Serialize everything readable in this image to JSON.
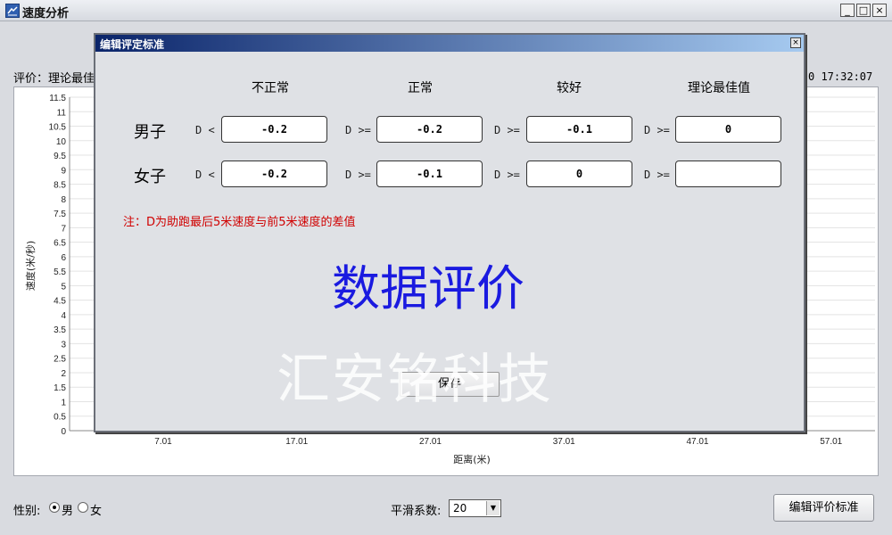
{
  "window": {
    "title": "速度分析",
    "min": "_",
    "max": "□",
    "close": "×"
  },
  "status": {
    "evaluation": "评价：理论最佳",
    "datetime": "0 17:32:07"
  },
  "chart_data": {
    "type": "line",
    "xlabel": "距离(米)",
    "ylabel": "速度(米/秒)",
    "xticks": [
      "7.01",
      "17.01",
      "27.01",
      "37.01",
      "47.01",
      "57.01"
    ],
    "yticks": [
      "0",
      "0.5",
      "1",
      "1.5",
      "2",
      "2.5",
      "3",
      "3.5",
      "4",
      "4.5",
      "5",
      "5.5",
      "6",
      "6.5",
      "7",
      "7.5",
      "8",
      "8.5",
      "9",
      "9.5",
      "10",
      "10.5",
      "11",
      "11.5"
    ],
    "ylim": [
      0,
      11.5
    ],
    "xlim": [
      0,
      57.01
    ],
    "series": [],
    "grid": true
  },
  "controls": {
    "gender_label": "性别:",
    "male": "男",
    "female": "女",
    "selected_gender": "男",
    "smooth_label": "平滑系数:",
    "smooth_value": "20",
    "edit_button": "编辑评价标准"
  },
  "dialog": {
    "title": "编辑评定标准",
    "close": "×",
    "columns": [
      "不正常",
      "正常",
      "较好",
      "理论最佳值"
    ],
    "rows": [
      {
        "label": "男子",
        "ops": [
          "D <",
          "D >=",
          "D >=",
          "D >="
        ],
        "values": [
          "-0.2",
          "-0.2",
          "-0.1",
          "0"
        ]
      },
      {
        "label": "女子",
        "ops": [
          "D <",
          "D >=",
          "D >=",
          "D >="
        ],
        "values": [
          "-0.2",
          "-0.1",
          "0",
          ""
        ]
      }
    ],
    "note": "注：D为助跑最后5米速度与前5米速度的差值",
    "big_title": "数据评价",
    "save_button": "保存",
    "watermark": "汇安铭科技"
  }
}
